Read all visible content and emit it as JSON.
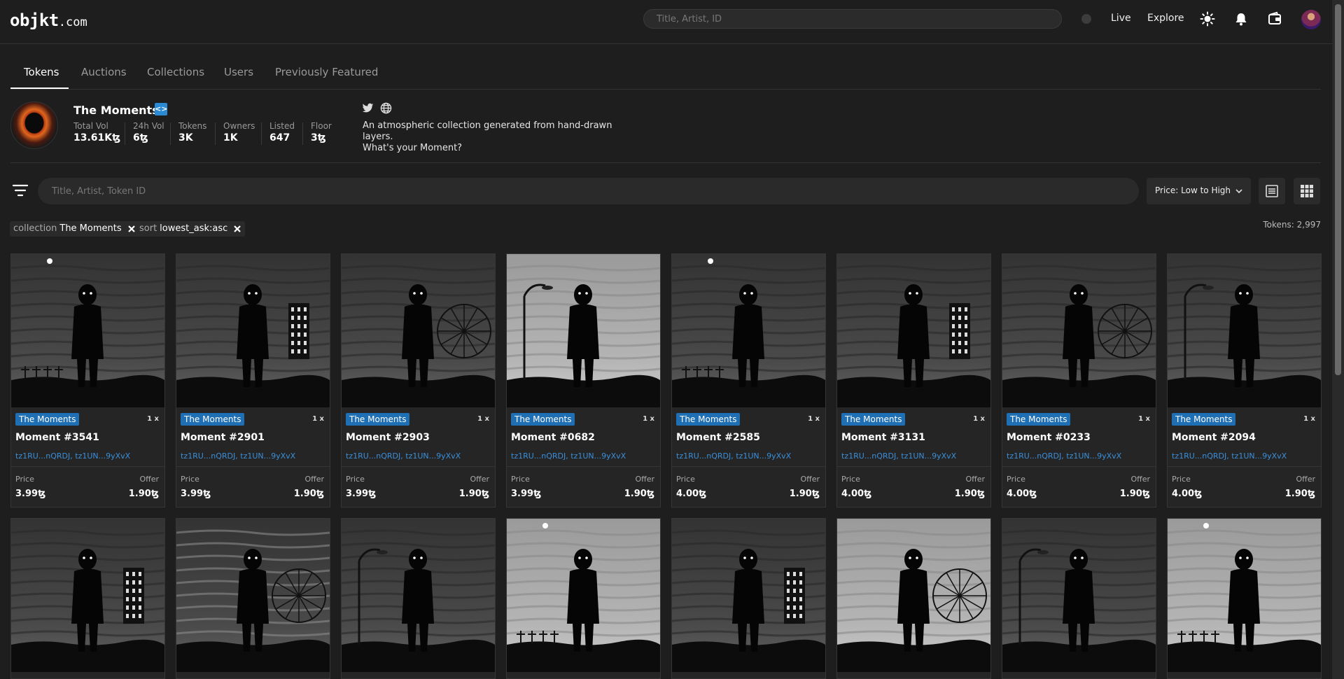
{
  "header": {
    "logo_main": "objkt",
    "logo_tld": ".com",
    "search_placeholder": "Title, Artist, ID",
    "nav": [
      "Live",
      "Explore"
    ]
  },
  "tabs": [
    {
      "label": "Tokens",
      "active": true
    },
    {
      "label": "Auctions",
      "active": false
    },
    {
      "label": "Collections",
      "active": false
    },
    {
      "label": "Users",
      "active": false
    },
    {
      "label": "Previously Featured",
      "active": false
    }
  ],
  "collection": {
    "name": "The Moments",
    "stats": [
      {
        "label": "Total Vol",
        "value": "13.61Kꜩ"
      },
      {
        "label": "24h Vol",
        "value": "6ꜩ"
      },
      {
        "label": "Tokens",
        "value": "3K"
      },
      {
        "label": "Owners",
        "value": "1K"
      },
      {
        "label": "Listed",
        "value": "647"
      },
      {
        "label": "Floor",
        "value": "3ꜩ"
      }
    ],
    "description_line1": "An atmospheric collection generated from hand-drawn layers.",
    "description_line2": "What's your Moment?"
  },
  "filter": {
    "search_placeholder": "Title, Artist, Token ID",
    "sort_value": "Price: Low to High"
  },
  "chips": [
    {
      "key": "collection",
      "value": "The Moments"
    },
    {
      "key": "sort",
      "value": "lowest_ask:asc"
    }
  ],
  "token_count": "Tokens: 2,997",
  "card_common": {
    "badge": "The Moments",
    "edition": "1 x",
    "creators": "tz1RU...nQRDJ, tz1UN...9yXvX",
    "price_label": "Price",
    "offer_label": "Offer"
  },
  "cards": [
    {
      "title": "Moment #3541",
      "price": "3.99ꜩ",
      "offer": "1.90ꜩ"
    },
    {
      "title": "Moment #2901",
      "price": "3.99ꜩ",
      "offer": "1.90ꜩ"
    },
    {
      "title": "Moment #2903",
      "price": "3.99ꜩ",
      "offer": "1.90ꜩ"
    },
    {
      "title": "Moment #0682",
      "price": "3.99ꜩ",
      "offer": "1.90ꜩ"
    },
    {
      "title": "Moment #2585",
      "price": "4.00ꜩ",
      "offer": "1.90ꜩ"
    },
    {
      "title": "Moment #3131",
      "price": "4.00ꜩ",
      "offer": "1.90ꜩ"
    },
    {
      "title": "Moment #0233",
      "price": "4.00ꜩ",
      "offer": "1.90ꜩ"
    },
    {
      "title": "Moment #2094",
      "price": "4.00ꜩ",
      "offer": "1.90ꜩ"
    }
  ],
  "icons": {
    "theme": "sun-icon",
    "notifications": "bell-icon",
    "wallet": "wallet-icon",
    "twitter": "twitter-icon",
    "website": "globe-icon",
    "filter": "filter-icon",
    "list_view": "list-view-icon",
    "grid_view": "grid-view-icon"
  },
  "colors": {
    "background": "#1e1e1e",
    "badge": "#1f6fb5",
    "link": "#3b8fd9"
  }
}
